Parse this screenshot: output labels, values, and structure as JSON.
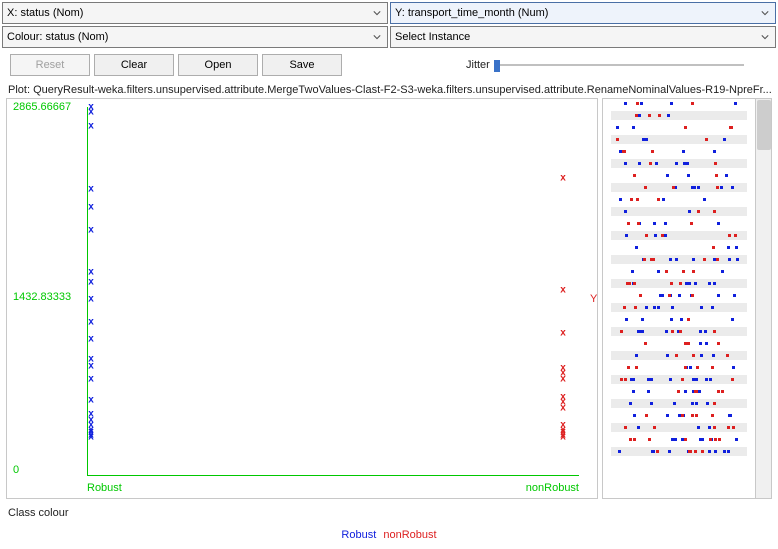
{
  "dropdowns": {
    "x": "X: status (Nom)",
    "y": "Y: transport_time_month (Num)",
    "colour": "Colour: status (Nom)",
    "instance": "Select Instance"
  },
  "buttons": {
    "reset": "Reset",
    "clear": "Clear",
    "open": "Open",
    "save": "Save"
  },
  "jitter_label": "Jitter",
  "plot_title": "Plot: QueryResult-weka.filters.unsupervised.attribute.MergeTwoValues-Clast-F2-S3-weka.filters.unsupervised.attribute.RenameNominalValues-R19-NpreFr...",
  "axis": {
    "y_top": "2865.66667",
    "y_mid": "1432.83333",
    "y_zero": "0",
    "x_left": "Robust",
    "x_right": "nonRobust"
  },
  "side_y_label": "Y",
  "class_colour_label": "Class colour",
  "legend": {
    "robust": "Robust",
    "nonrobust": "nonRobust"
  },
  "colours": {
    "robust": "#1020dd",
    "nonrobust": "#dd2020",
    "axis": "#00c800"
  },
  "chart_data": {
    "type": "scatter",
    "title": "",
    "xlabel": "status (Nom)",
    "ylabel": "transport_time_month (Num)",
    "ylim": [
      0,
      2865.66667
    ],
    "categories": [
      "Robust",
      "nonRobust"
    ],
    "series": [
      {
        "name": "Robust",
        "colour": "#1020dd",
        "points": [
          {
            "x": "Robust",
            "y": 2865.67
          },
          {
            "x": "Robust",
            "y": 2820
          },
          {
            "x": "Robust",
            "y": 2700
          },
          {
            "x": "Robust",
            "y": 2150
          },
          {
            "x": "Robust",
            "y": 2000
          },
          {
            "x": "Robust",
            "y": 1800
          },
          {
            "x": "Robust",
            "y": 1430
          },
          {
            "x": "Robust",
            "y": 1350
          },
          {
            "x": "Robust",
            "y": 1200
          },
          {
            "x": "Robust",
            "y": 1000
          },
          {
            "x": "Robust",
            "y": 850
          },
          {
            "x": "Robust",
            "y": 680
          },
          {
            "x": "Robust",
            "y": 620
          },
          {
            "x": "Robust",
            "y": 500
          },
          {
            "x": "Robust",
            "y": 320
          },
          {
            "x": "Robust",
            "y": 200
          },
          {
            "x": "Robust",
            "y": 150
          },
          {
            "x": "Robust",
            "y": 100
          },
          {
            "x": "Robust",
            "y": 60
          },
          {
            "x": "Robust",
            "y": 40
          },
          {
            "x": "Robust",
            "y": 20
          },
          {
            "x": "Robust",
            "y": 0
          }
        ]
      },
      {
        "name": "nonRobust",
        "colour": "#dd2020",
        "points": [
          {
            "x": "nonRobust",
            "y": 2250
          },
          {
            "x": "nonRobust",
            "y": 1280
          },
          {
            "x": "nonRobust",
            "y": 900
          },
          {
            "x": "nonRobust",
            "y": 600
          },
          {
            "x": "nonRobust",
            "y": 560
          },
          {
            "x": "nonRobust",
            "y": 500
          },
          {
            "x": "nonRobust",
            "y": 350
          },
          {
            "x": "nonRobust",
            "y": 300
          },
          {
            "x": "nonRobust",
            "y": 250
          },
          {
            "x": "nonRobust",
            "y": 100
          },
          {
            "x": "nonRobust",
            "y": 60
          },
          {
            "x": "nonRobust",
            "y": 40
          },
          {
            "x": "nonRobust",
            "y": 20
          },
          {
            "x": "nonRobust",
            "y": 0
          }
        ]
      }
    ]
  }
}
